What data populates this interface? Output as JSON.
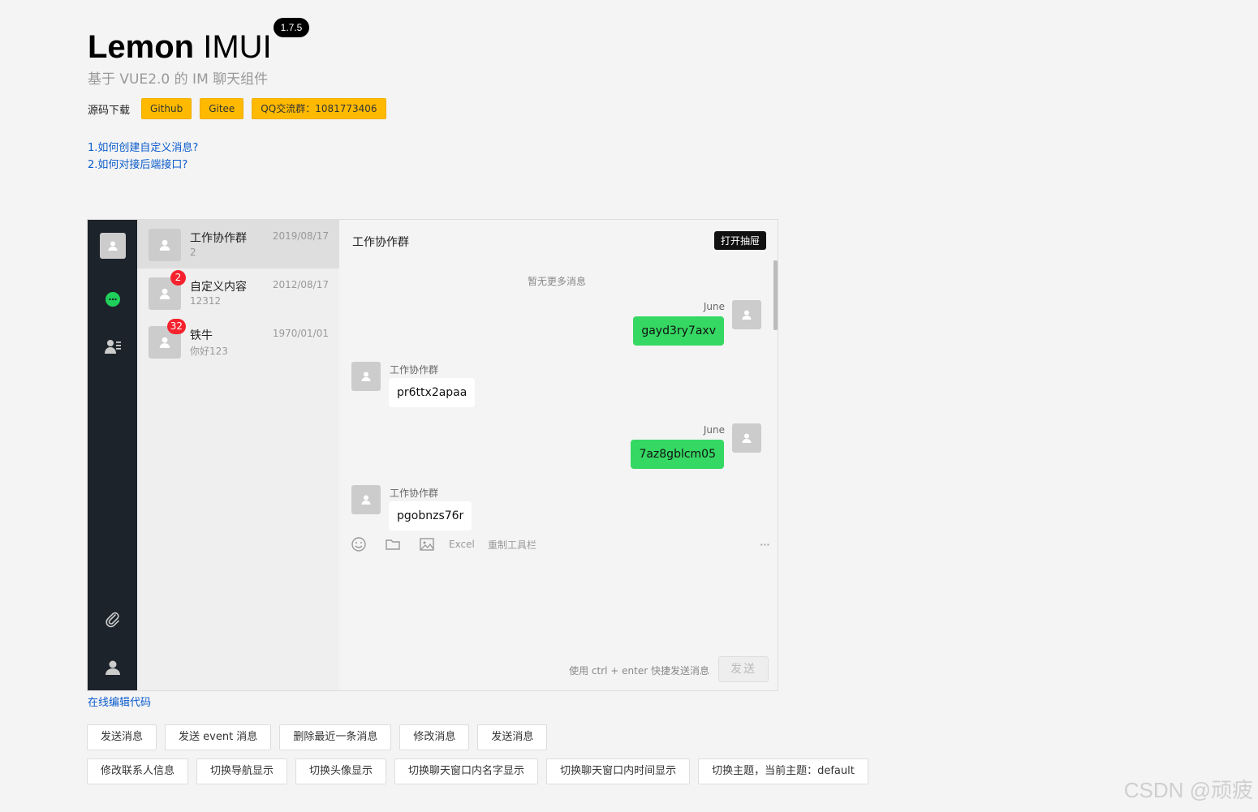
{
  "header": {
    "title_bold": "Lemon",
    "title_light": "IMUI",
    "version": "1.7.5",
    "subtitle": "基于 VUE2.0 的 IM 聊天组件",
    "download_label": "源码下载",
    "download_buttons": [
      "Github",
      "Gitee",
      "QQ交流群：1081773406"
    ],
    "links": [
      "1.如何创建自定义消息?",
      "2.如何对接后端接口?"
    ]
  },
  "contacts": [
    {
      "name": "工作协作群",
      "time": "2019/08/17",
      "last": "2",
      "badge": "",
      "active": true
    },
    {
      "name": "自定义内容",
      "time": "2012/08/17",
      "last": "12312",
      "badge": "2",
      "active": false
    },
    {
      "name": "铁牛",
      "time": "1970/01/01",
      "last": "你好123",
      "badge": "32",
      "active": false
    }
  ],
  "chat": {
    "title": "工作协作群",
    "drawer_button": "打开抽屉",
    "no_more": "暂无更多消息",
    "messages": [
      {
        "from": "June",
        "text": "gayd3ry7axv",
        "mine": true
      },
      {
        "from": "工作协作群",
        "text": "pr6ttx2apaa",
        "mine": false
      },
      {
        "from": "June",
        "text": "7az8gblcm05",
        "mine": true
      },
      {
        "from": "工作协作群",
        "text": "pgobnzs76r",
        "mine": false
      }
    ],
    "toolbar": {
      "excel": "Excel",
      "reset": "重制工具栏",
      "more": "···"
    },
    "hint": "使用 ctrl + enter 快捷发送消息",
    "send": "发送"
  },
  "edit_link": "在线编辑代码",
  "actions_row1": [
    "发送消息",
    "发送 event 消息",
    "删除最近一条消息",
    "修改消息",
    "发送消息"
  ],
  "actions_row2": [
    "修改联系人信息",
    "切换导航显示",
    "切换头像显示",
    "切换聊天窗口内名字显示",
    "切换聊天窗口内时间显示",
    "切换主题，当前主题：default"
  ],
  "watermark": "CSDN @顽疲",
  "colors": {
    "accent": "#ffba00",
    "nav_bg": "#1d232a",
    "bubble_mine": "#35d863",
    "badge": "#f5222d",
    "link": "#0b5ccd"
  }
}
